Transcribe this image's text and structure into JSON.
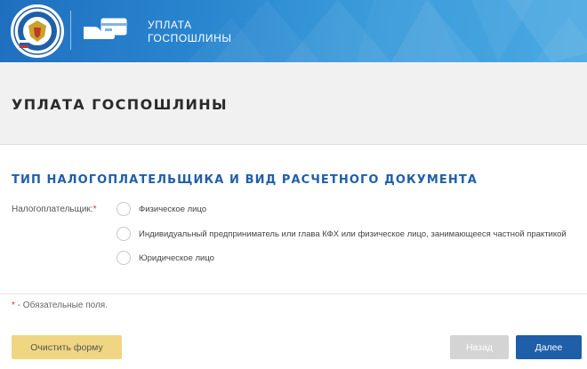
{
  "header": {
    "title_line1": "УПЛАТА",
    "title_line2": "ГОСПОШЛИНЫ",
    "logo_icon": "fns-emblem-icon",
    "service_icon": "hand-card-icon"
  },
  "page": {
    "title": "УПЛАТА ГОСПОШЛИНЫ"
  },
  "section": {
    "title": "ТИП НАЛОГОПЛАТЕЛЬЩИКА И ВИД РАСЧЕТНОГО ДОКУМЕНТА"
  },
  "taxpayer": {
    "label": "Налогоплательщик:",
    "required_mark": "*",
    "options": [
      "Физическое лицо",
      "Индивидуальный предприниматель или глава КФХ или физическое лицо, занимающееся частной практикой",
      "Юридическое лицо"
    ]
  },
  "required_note": {
    "star": "*",
    "text": " - Обязательные поля."
  },
  "buttons": {
    "clear": "Очистить форму",
    "back": "Назад",
    "next": "Далее"
  },
  "colors": {
    "header_blue": "#2a86cf",
    "title_blue": "#1f5fa9",
    "clear_button": "#f0d682",
    "back_button_disabled": "#d4d4d4",
    "next_button": "#1f5fa9",
    "required_red": "#d0312d"
  }
}
